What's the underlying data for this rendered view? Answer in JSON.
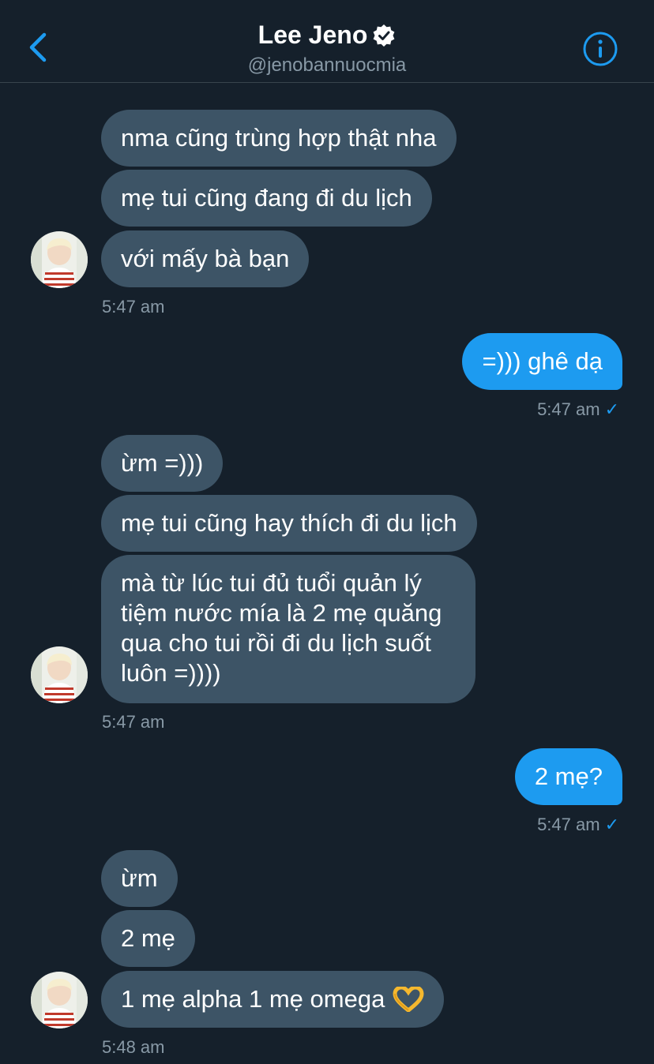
{
  "header": {
    "name": "Lee Jeno",
    "handle": "@jenobannuocmia"
  },
  "messages": [
    {
      "text": "nma cũng trùng hợp thật nha"
    },
    {
      "text": "mẹ tui cũng đang đi du lịch"
    },
    {
      "text": "với mấy bà bạn"
    },
    {
      "time": "5:47 am"
    },
    {
      "text": "=))) ghê dạ"
    },
    {
      "time": "5:47 am",
      "status": "✓"
    },
    {
      "text": "ừm =)))"
    },
    {
      "text": "mẹ tui cũng hay thích đi du lịch"
    },
    {
      "text": "mà từ lúc tui đủ tuổi quản lý tiệm nước mía là 2 mẹ quăng qua cho tui rồi đi du lịch suốt luôn =))))"
    },
    {
      "time": "5:47 am"
    },
    {
      "text": "2 mẹ?"
    },
    {
      "time": "5:47 am",
      "status": "✓"
    },
    {
      "text": "ừm"
    },
    {
      "text": "2 mẹ"
    },
    {
      "text": "1 mẹ alpha 1 mẹ omega",
      "emoji": "heart-hands"
    },
    {
      "time": "5:48 am"
    }
  ],
  "colors": {
    "background": "#15202b",
    "incoming_bubble": "#3d5466",
    "outgoing_bubble": "#1d9bf0",
    "accent": "#1d9bf0",
    "muted_text": "#8899a6"
  }
}
